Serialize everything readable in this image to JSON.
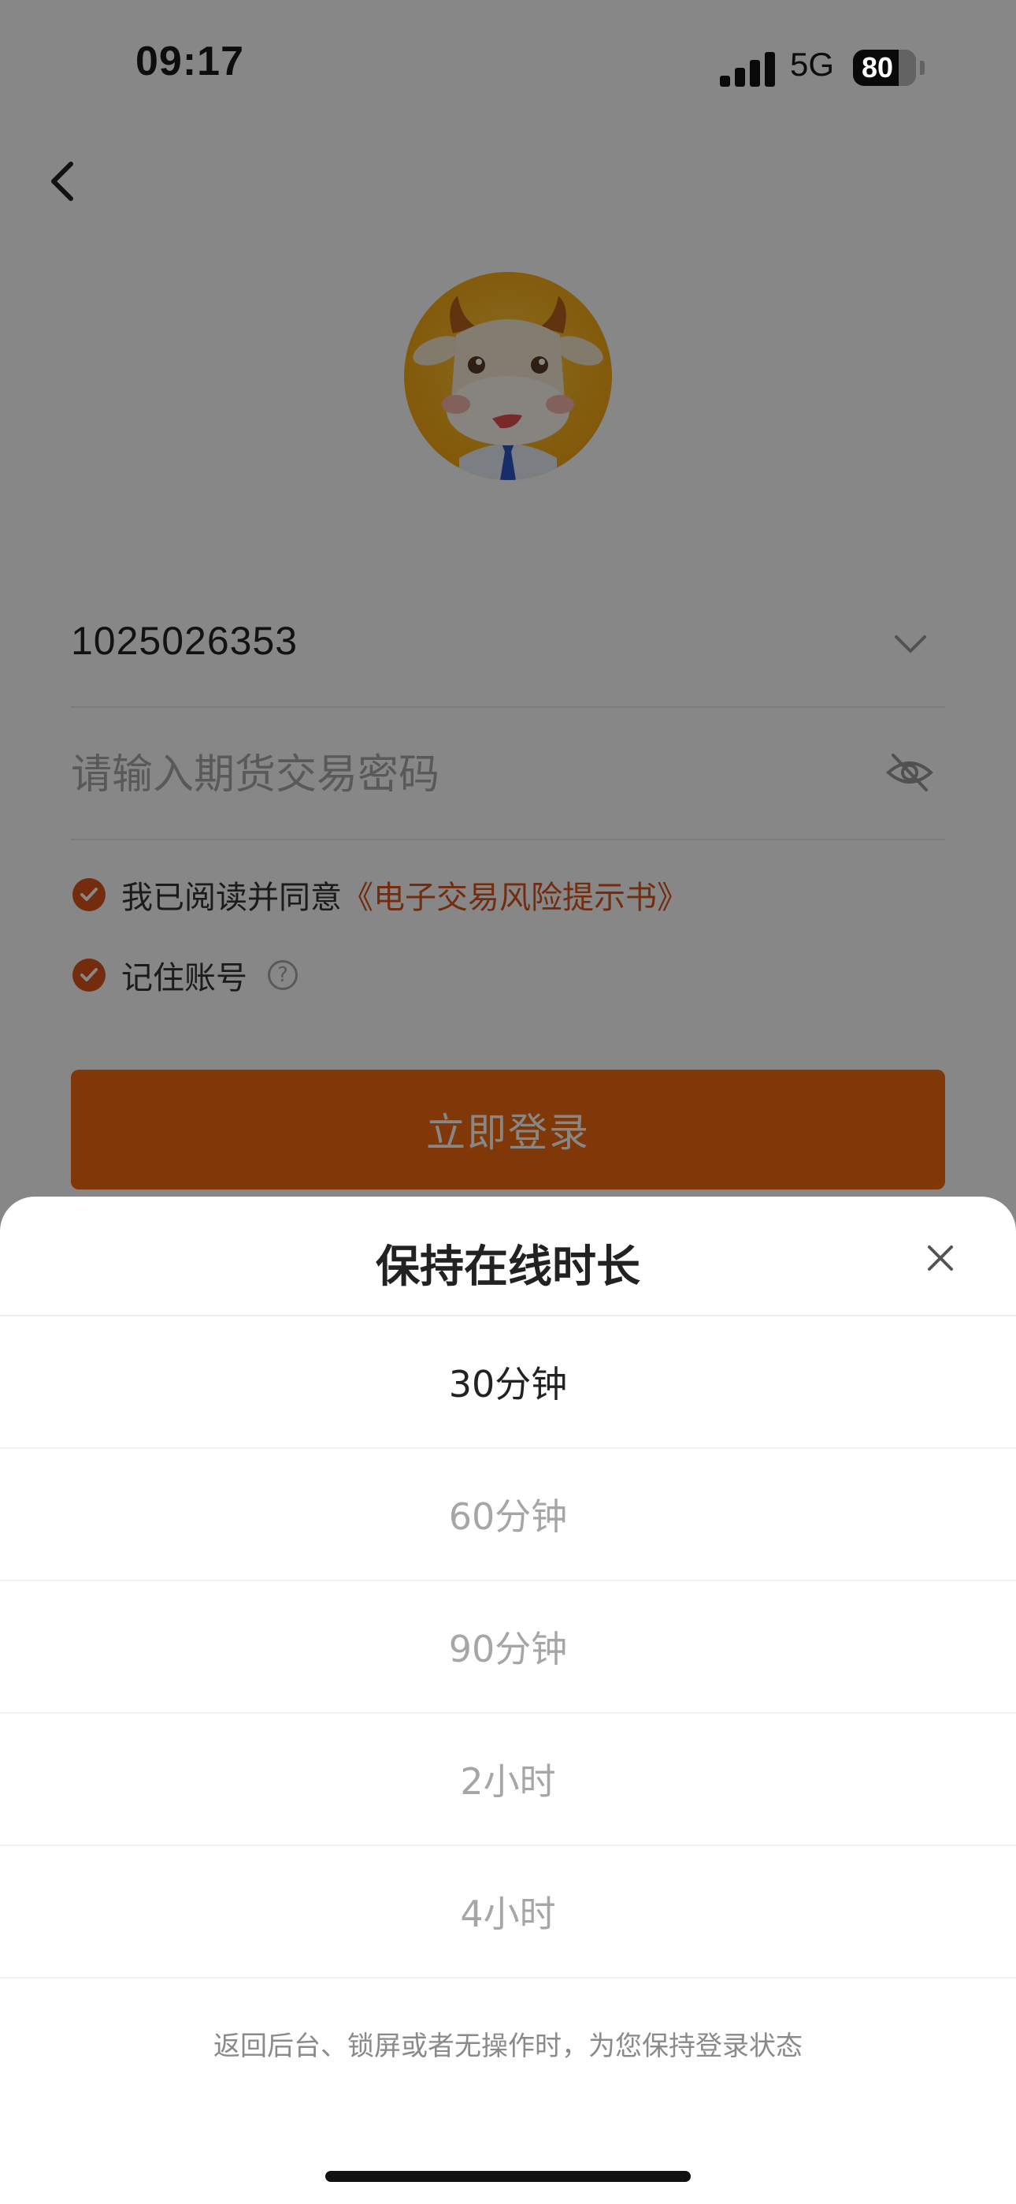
{
  "status_bar": {
    "time": "09:17",
    "network": "5G",
    "battery": "80"
  },
  "login": {
    "account": "1025026353",
    "password_placeholder": "请输入期货交易密码",
    "agree_text": "我已阅读并同意",
    "agree_link": "《电子交易风险提示书》",
    "remember_label": "记住账号",
    "help_glyph": "?",
    "submit_label": "立即登录"
  },
  "sheet": {
    "title": "保持在线时长",
    "options": [
      {
        "label": "30分钟",
        "selected": true
      },
      {
        "label": "60分钟",
        "selected": false
      },
      {
        "label": "90分钟",
        "selected": false
      },
      {
        "label": "2小时",
        "selected": false
      },
      {
        "label": "4小时",
        "selected": false
      }
    ],
    "note": "返回后台、锁屏或者无操作时，为您保持登录状态"
  },
  "colors": {
    "accent": "#f26a10",
    "check": "#d9531c"
  },
  "icons": [
    "back-icon",
    "signal-icon",
    "battery-icon",
    "chevron-down-icon",
    "eye-off-icon",
    "check-icon",
    "help-icon",
    "close-icon"
  ]
}
